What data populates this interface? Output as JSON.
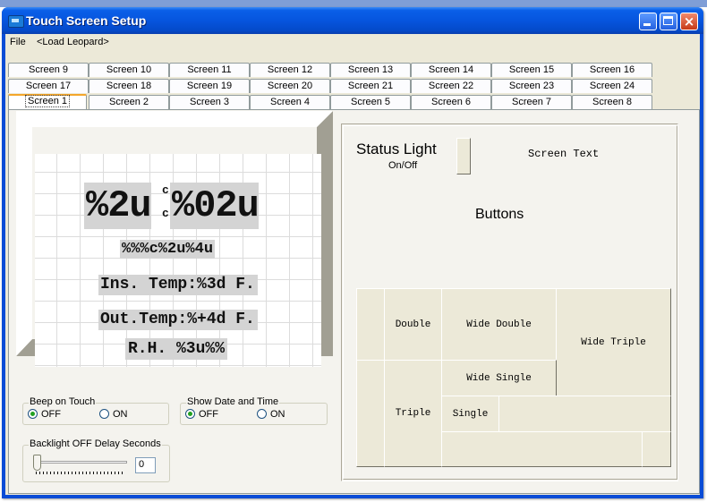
{
  "window": {
    "title": "Touch Screen Setup"
  },
  "menu": [
    {
      "label": "File"
    },
    {
      "label": "<Load Leopard>"
    }
  ],
  "tabs": {
    "row1": [
      "Screen 9",
      "Screen 10",
      "Screen 11",
      "Screen 12",
      "Screen 13",
      "Screen 14",
      "Screen 15",
      "Screen 16"
    ],
    "row2": [
      "Screen 17",
      "Screen 18",
      "Screen 19",
      "Screen 20",
      "Screen 21",
      "Screen 22",
      "Screen 23",
      "Screen 24"
    ],
    "row3": [
      "Screen 1",
      "Screen 2",
      "Screen 3",
      "Screen 4",
      "Screen 5",
      "Screen 6",
      "Screen 7",
      "Screen 8"
    ],
    "selected": "Screen 1"
  },
  "lcd": {
    "hours": "%2u",
    "colon_top": "c",
    "colon_bottom": "c",
    "minutes": "%02u",
    "date": "%%%c%2u%4u",
    "ins_temp": "Ins. Temp:%3d F.",
    "out_temp": "Out.Temp:%+4d F.",
    "rh": "R.H. %3u%%"
  },
  "beep": {
    "label": "Beep on Touch",
    "off": "OFF",
    "on": "ON",
    "selected": "OFF"
  },
  "datetime": {
    "label": "Show Date and Time",
    "off": "OFF",
    "on": "ON",
    "selected": "OFF"
  },
  "backlight": {
    "label": "Backlight OFF Delay Seconds",
    "value": "0",
    "slider_fraction": 0
  },
  "right": {
    "status_light": "Status Light",
    "on_off": "On/Off",
    "screen_text": "Screen Text",
    "buttons": "Buttons",
    "grid": {
      "double": "Double",
      "wide_double": "Wide Double",
      "wide_triple": "Wide Triple",
      "wide_single": "Wide Single",
      "triple": "Triple",
      "single": "Single"
    }
  },
  "colors": {
    "titlebar": "#0a5fe8",
    "face": "#ece9d8",
    "tab_highlight": "#f3a62b"
  }
}
